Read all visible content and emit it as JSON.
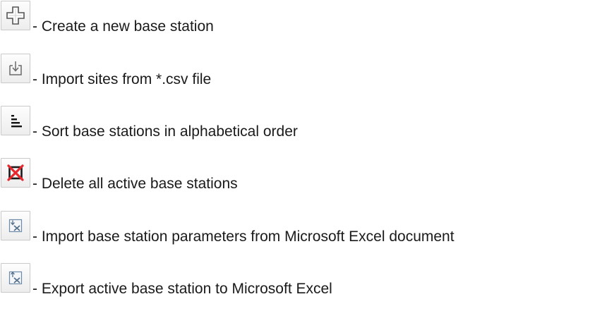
{
  "toolbar_legend": {
    "items": [
      {
        "icon": "add-base-station-icon",
        "description": "- Create a new base station"
      },
      {
        "icon": "import-csv-icon",
        "description": "- Import sites from *.csv file"
      },
      {
        "icon": "sort-alphabetical-icon",
        "description": "- Sort base stations in alphabetical order"
      },
      {
        "icon": "delete-all-icon",
        "description": "- Delete all active base stations"
      },
      {
        "icon": "import-excel-icon",
        "description": "- Import base station parameters from Microsoft Excel document"
      },
      {
        "icon": "export-excel-icon",
        "description": "- Export active base station to Microsoft Excel"
      }
    ]
  },
  "colors": {
    "delete_cross": "#e8262b",
    "icon_stroke": "#5a5a5a",
    "excel_icon": "#6e8aa8"
  }
}
